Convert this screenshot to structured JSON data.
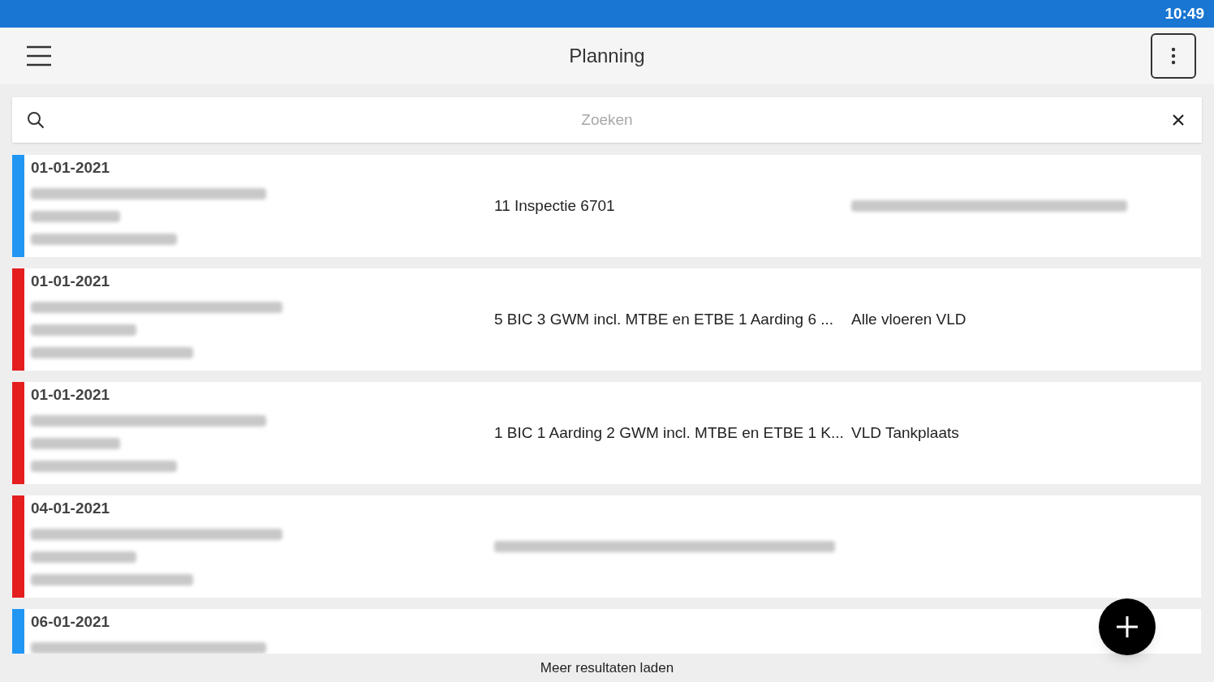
{
  "status_bar": {
    "time": "10:49"
  },
  "app_bar": {
    "title": "Planning"
  },
  "search": {
    "placeholder": "Zoeken"
  },
  "rows": [
    {
      "color": "#2196f3",
      "date": "01-01-2021",
      "details": [
        {
          "kind": "redacted"
        },
        {
          "kind": "redacted"
        },
        {
          "kind": "redacted"
        }
      ],
      "column_2": {
        "kind": "text",
        "text": "11 Inspectie 6701"
      },
      "column_3": {
        "kind": "redacted"
      }
    },
    {
      "color": "#e41e1e",
      "date": "01-01-2021",
      "details": [
        {
          "kind": "redacted"
        },
        {
          "kind": "redacted"
        },
        {
          "kind": "redacted"
        }
      ],
      "column_2": {
        "kind": "text",
        "text": "5 BIC 3 GWM incl. MTBE en ETBE 1 Aarding 6 ..."
      },
      "column_3": {
        "kind": "text",
        "text": "Alle vloeren VLD"
      }
    },
    {
      "color": "#e41e1e",
      "date": "01-01-2021",
      "details": [
        {
          "kind": "redacted"
        },
        {
          "kind": "redacted"
        },
        {
          "kind": "redacted"
        }
      ],
      "column_2": {
        "kind": "text",
        "text": "1 BIC 1 Aarding 2 GWM incl. MTBE en ETBE 1 K..."
      },
      "column_3": {
        "kind": "text",
        "text": "VLD Tankplaats"
      }
    },
    {
      "color": "#e41e1e",
      "date": "04-01-2021",
      "details": [
        {
          "kind": "redacted"
        },
        {
          "kind": "redacted"
        },
        {
          "kind": "redacted"
        }
      ],
      "column_2": {
        "kind": "redacted"
      }
    },
    {
      "color": "#2196f3",
      "date": "06-01-2021",
      "details": [
        {
          "kind": "redacted"
        }
      ]
    }
  ],
  "footer": {
    "link": "Meer resultaten laden"
  }
}
